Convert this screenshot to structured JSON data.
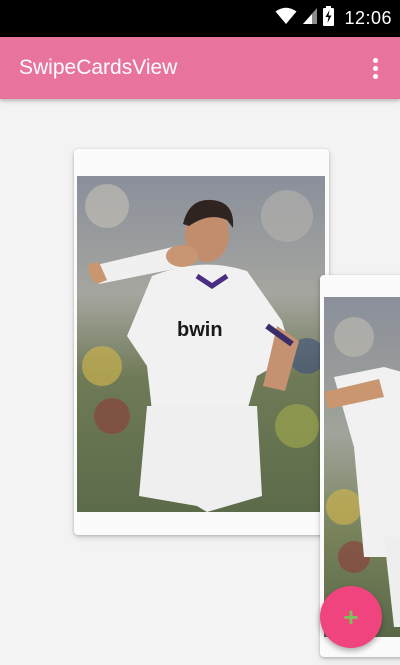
{
  "status_bar": {
    "time": "12:06",
    "icons": [
      "wifi-icon",
      "signal-icon",
      "battery-charging-icon"
    ]
  },
  "app_bar": {
    "title": "SwipeCardsView",
    "menu_icon": "overflow-menu-icon"
  },
  "cards": [
    {
      "image": "football-player-photo"
    },
    {
      "image": "football-player-photo"
    }
  ],
  "fab": {
    "label": "+",
    "icon": "add-icon"
  },
  "colors": {
    "app_bar": "#e8739d",
    "fab": "#f0447f",
    "fab_icon": "#7bc15a",
    "background": "#f3f3f3"
  }
}
